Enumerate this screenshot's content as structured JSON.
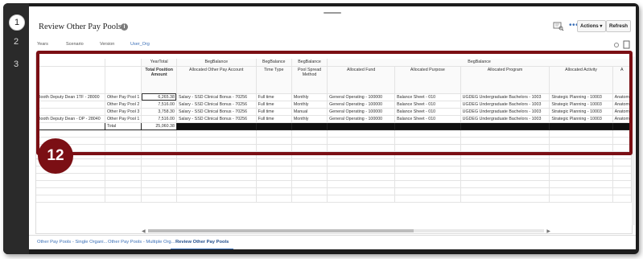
{
  "steps": [
    "1",
    "2",
    "3"
  ],
  "page": {
    "title": "Review Other Pay Pools",
    "actions_label": "Actions ▾",
    "refresh_label": "Refresh",
    "more_label": "•••"
  },
  "pov": {
    "years": "Years",
    "scenario": "Scenario",
    "version": "Version",
    "user_org": "User_Org"
  },
  "grid": {
    "measure_header": "YearTotal",
    "beg_balance": "BegBalance",
    "columns": {
      "total_position_amount": "Total Position Amount",
      "allocated_other_pay_account": "Allocated Other Pay Account",
      "time_type": "Time Type",
      "pool_spread_method": "Pool Spread Method",
      "allocated_fund": "Allocated Fund",
      "allocated_purpose": "Allocated Purpose",
      "allocated_program": "Allocated Program",
      "allocated_activity": "Allocated Activity",
      "next_column": "A"
    },
    "rows": [
      {
        "position": "Booth Deputy Dean 1TF - 28000",
        "pool": "Other Pay Pool 1",
        "amount": "6,265.38",
        "account": "Salary - SSD Clinical Bonus - 70256",
        "time_type": "Full time",
        "spread": "Monthly",
        "fund": "General Operating - 100000",
        "purpose": "Balance Sheet - 010",
        "program": "UGDEG Undergraduate Bachelors - 1003",
        "activity": "Strategic Planning - 10003",
        "next": "Anatom"
      },
      {
        "position": "",
        "pool": "Other Pay Pool 2",
        "amount": "7,516.00",
        "account": "Salary - SSD Clinical Bonus - 70256",
        "time_type": "Full time",
        "spread": "Monthly",
        "fund": "General Operating - 100000",
        "purpose": "Balance Sheet - 010",
        "program": "UGDEG Undergraduate Bachelors - 1003",
        "activity": "Strategic Planning - 10003",
        "next": "Anatom"
      },
      {
        "position": "",
        "pool": "Other Pay Pool 3",
        "amount": "3,758.30",
        "account": "Salary - SSD Clinical Bonus - 70256",
        "time_type": "Full time",
        "spread": "Manual",
        "fund": "General Operating - 100000",
        "purpose": "Balance Sheet - 010",
        "program": "UGDEG Undergraduate Bachelors - 1003",
        "activity": "Strategic Planning - 10003",
        "next": "Anatom"
      },
      {
        "position": "Booth Deputy Dean - DP - 28040",
        "pool": "Other Pay Pool 1",
        "amount": "7,516.00",
        "account": "Salary - SSD Clinical Bonus - 70256",
        "time_type": "Full time",
        "spread": "Monthly",
        "fund": "General Operating - 100000",
        "purpose": "Balance Sheet - 010",
        "program": "UGDEG Undergraduate Bachelors - 1003",
        "activity": "Strategic Planning - 10003",
        "next": "Anatom"
      }
    ],
    "total_row": {
      "position": "-",
      "pool": "Total",
      "amount": "25,060.38"
    }
  },
  "callout": {
    "number": "12"
  },
  "tabs": [
    {
      "label": "Other Pay Pools - Single Organi..."
    },
    {
      "label": "Other Pay Pools - Multiple Org..."
    },
    {
      "label": "Review Other Pay Pools"
    }
  ],
  "colors": {
    "accent": "#7b0f14",
    "link": "#3a6fb7"
  }
}
